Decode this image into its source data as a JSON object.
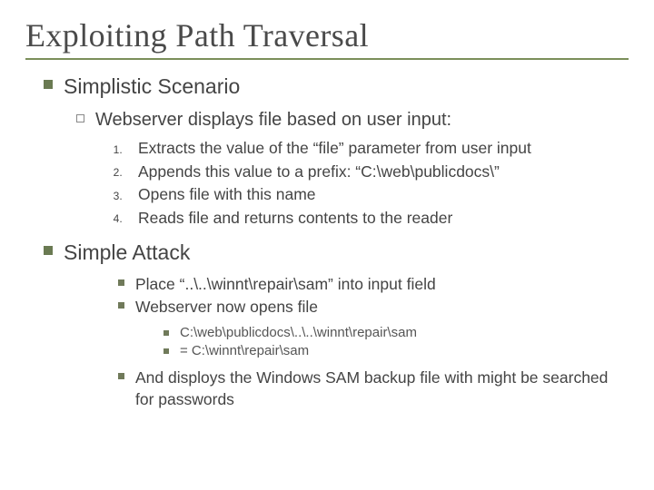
{
  "title": "Exploiting Path Traversal",
  "simplistic": {
    "label": "Simplistic Scenario",
    "webserver_intro": "Webserver displays file based on user input:",
    "steps": {
      "s1": "Extracts the value of the “file” parameter from user input",
      "s2": "Appends this value to a prefix: “C:\\web\\publicdocs\\”",
      "s3": "Opens file with this name",
      "s4": "Reads file and returns contents to the reader"
    }
  },
  "simple_attack": {
    "label": "Simple Attack",
    "place": "Place “..\\..\\winnt\\repair\\sam” into input field",
    "opens": "Webserver now opens file",
    "paths": {
      "p1": "C:\\web\\publicdocs\\..\\..\\winnt\\repair\\sam",
      "p2": "= C:\\winnt\\repair\\sam"
    },
    "conclusion": "And disploys the Windows SAM backup file with might be searched for passwords"
  }
}
